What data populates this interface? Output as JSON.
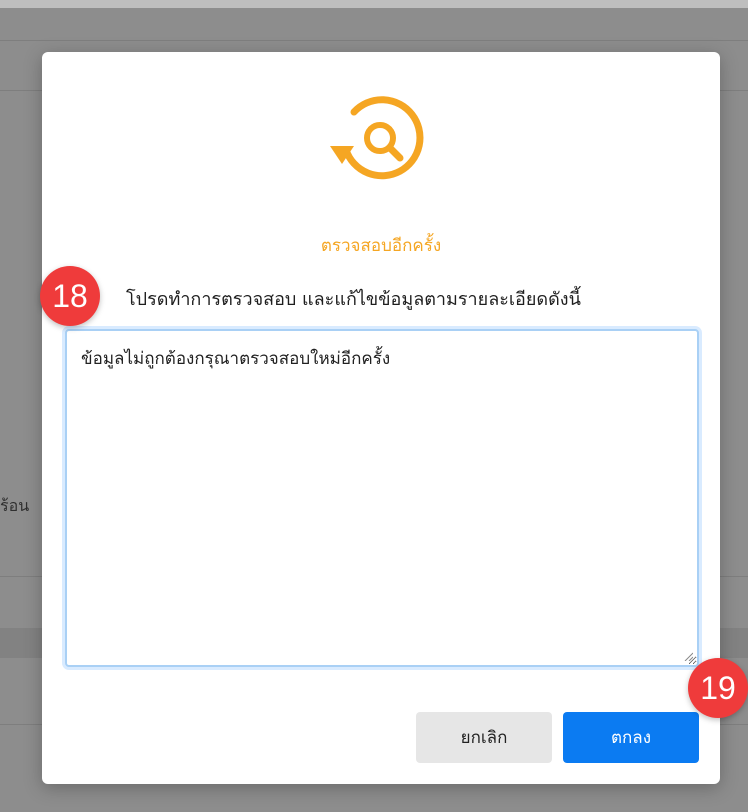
{
  "background": {
    "fragment_text": "ร้อน"
  },
  "modal": {
    "icon": "refresh-search-icon",
    "title": "ตรวจสอบอีกครั้ง",
    "message": "โปรดทำการตรวจสอบ และแก้ไขข้อมูลตามรายละเอียดดังนี้",
    "textarea_value": "ข้อมูลไม่ถูกต้องกรุณาตรวจสอบใหม่อีกครั้ง",
    "cancel_label": "ยกเลิก",
    "ok_label": "ตกลง"
  },
  "markers": {
    "first": "18",
    "second": "19"
  },
  "colors": {
    "accent": "#f5a623",
    "primary": "#0b7bf2",
    "marker": "#ef3b3b"
  }
}
